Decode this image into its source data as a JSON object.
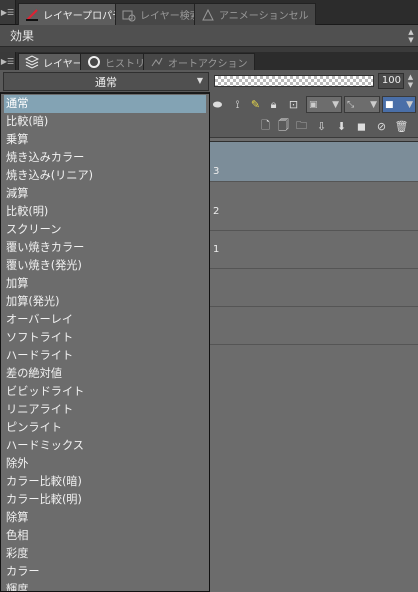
{
  "top_tabs": [
    {
      "label": "レイヤープロパティ",
      "active": true,
      "icon": "layer-property-icon"
    },
    {
      "label": "レイヤー検索",
      "active": false,
      "icon": "layer-search-icon"
    },
    {
      "label": "アニメーションセル",
      "active": false,
      "icon": "animation-cel-icon"
    }
  ],
  "effect_label": "効果",
  "second_tabs": [
    {
      "label": "レイヤー",
      "active": true,
      "icon": "layers-icon"
    },
    {
      "label": "ヒストリー",
      "active": false,
      "icon": "history-icon"
    },
    {
      "label": "オートアクション",
      "active": false,
      "icon": "auto-action-icon"
    }
  ],
  "blend_mode": {
    "selected": "通常"
  },
  "opacity": {
    "value": "100"
  },
  "blend_options": [
    "通常",
    "比較(暗)",
    "乗算",
    "焼き込みカラー",
    "焼き込み(リニア)",
    "減算",
    "比較(明)",
    "スクリーン",
    "覆い焼きカラー",
    "覆い焼き(発光)",
    "加算",
    "加算(発光)",
    "オーバーレイ",
    "ソフトライト",
    "ハードライト",
    "差の絶対値",
    "ビビッドライト",
    "リニアライト",
    "ピンライト",
    "ハードミックス",
    "除外",
    "カラー比較(暗)",
    "カラー比較(明)",
    "除算",
    "色相",
    "彩度",
    "カラー",
    "輝度"
  ],
  "layers": [
    {
      "number": "3",
      "selected": true
    },
    {
      "number": "2",
      "selected": false
    },
    {
      "number": "1",
      "selected": false
    },
    {
      "number": "",
      "selected": false
    },
    {
      "number": "",
      "selected": false
    }
  ],
  "colors": {
    "selection_blue": "#83a3b4",
    "panel_bg": "#6c6c6c",
    "layer_selected": "#7c8d99"
  }
}
